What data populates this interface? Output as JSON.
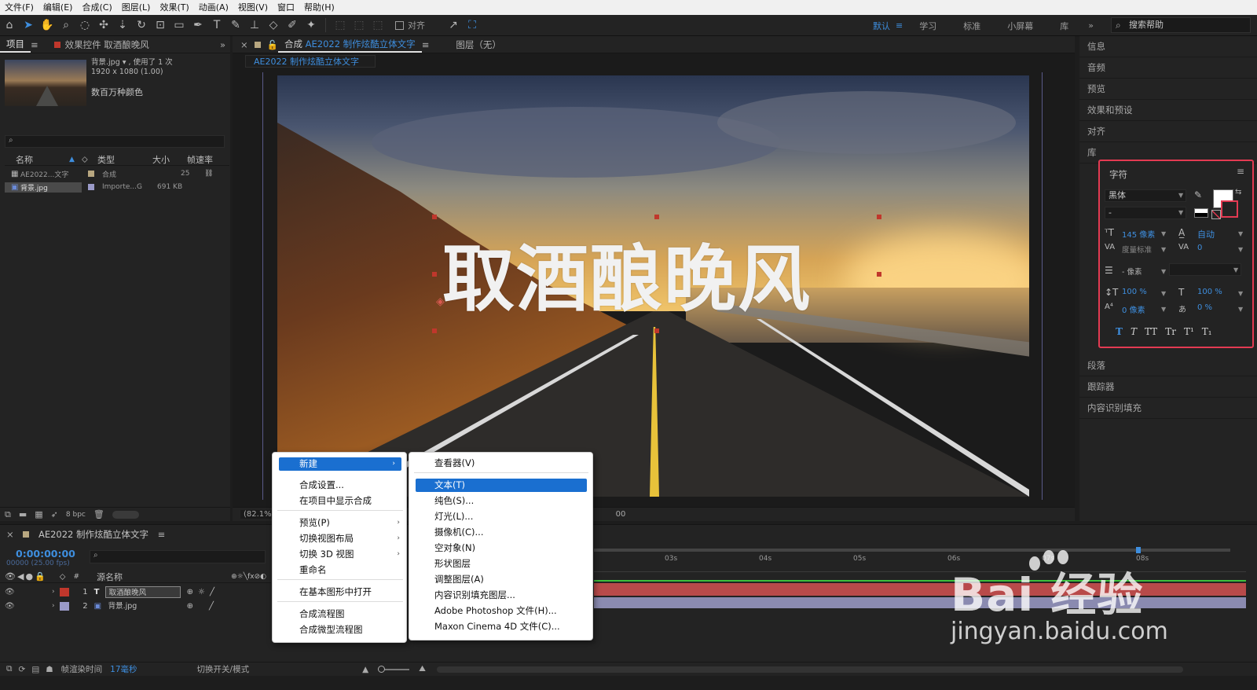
{
  "menubar": [
    "文件(F)",
    "编辑(E)",
    "合成(C)",
    "图层(L)",
    "效果(T)",
    "动画(A)",
    "视图(V)",
    "窗口",
    "帮助(H)"
  ],
  "toolbar": {
    "align_label": "对齐",
    "workspaces": [
      "默认",
      "学习",
      "标准",
      "小屏幕",
      "库"
    ],
    "selected_workspace": "默认",
    "search_placeholder": "搜索帮助"
  },
  "project": {
    "tab_project": "项目",
    "tab_effects": "效果控件 取酒酿晚风",
    "asset_name": "背景.jpg ▾ , 使用了 1 次",
    "asset_size": "1920 x 1080 (1.00)",
    "asset_colors": "数百万种颜色",
    "columns": [
      "名称",
      "类型",
      "大小",
      "帧速率"
    ],
    "items": [
      {
        "name": "AE2022...文字",
        "type": "合成",
        "size": "",
        "fps": "25",
        "color": "#b8a780"
      },
      {
        "name": "背景.jpg",
        "type": "Importe...G",
        "size": "691 KB",
        "fps": "",
        "color": "#9a9ac8"
      }
    ],
    "bpc": "8 bpc"
  },
  "comp": {
    "tab_label": "合成",
    "tab_name": "AE2022 制作炫酷立体文字",
    "layer_tab": "图层（无）",
    "sub_tab": "AE2022 制作炫酷立体文字",
    "title_text": "取酒酿晚风",
    "zoom": "(82.1%)",
    "timecode_tail": "00"
  },
  "right_panels": [
    "信息",
    "音频",
    "预览",
    "效果和预设",
    "对齐",
    "库"
  ],
  "right_panels_below": [
    "段落",
    "跟踪器",
    "内容识别填充"
  ],
  "character": {
    "title": "字符",
    "font": "黑体",
    "style": "-",
    "font_size": "145 像素",
    "leading": "自动",
    "kerning": "度量标准",
    "tracking": "0",
    "stroke_width": "- 像素",
    "vscale": "100 %",
    "hscale": "100 %",
    "baseline": "0 像素",
    "tsume": "0 %",
    "styles": [
      "T",
      "T",
      "TT",
      "Tr",
      "T¹",
      "T₁"
    ]
  },
  "timeline": {
    "tab_name": "AE2022 制作炫酷立体文字",
    "timecode": "0:00:00:00",
    "fps": "00000 (25.00 fps)",
    "columns": [
      "#",
      "源名称"
    ],
    "layers": [
      {
        "num": "1",
        "name": "取酒酿晚风",
        "type_icon": "T",
        "color": "#c0372c"
      },
      {
        "num": "2",
        "name": "背景.jpg",
        "type_icon": "▣",
        "color": "#9a9ac8"
      }
    ],
    "ruler_ticks": [
      "03s",
      "04s",
      "05s",
      "06s",
      "07s",
      "08s"
    ],
    "render_label": "帧渲染时间",
    "render_value": "17毫秒",
    "switch_label": "切换开关/模式"
  },
  "context_menu": {
    "items": [
      {
        "label": "新建",
        "submenu": true,
        "highlight": true
      },
      {
        "label": "合成设置..."
      },
      {
        "label": "在项目中显示合成"
      },
      {
        "label": "预览(P)",
        "submenu": true
      },
      {
        "label": "切换视图布局",
        "submenu": true
      },
      {
        "label": "切换 3D 视图",
        "submenu": true
      },
      {
        "label": "重命名"
      },
      {
        "label": "在基本图形中打开"
      },
      {
        "label": "合成流程图"
      },
      {
        "label": "合成微型流程图"
      }
    ]
  },
  "submenu": {
    "items": [
      {
        "label": "查看器(V)"
      },
      {
        "label": "文本(T)",
        "highlight": true
      },
      {
        "label": "纯色(S)..."
      },
      {
        "label": "灯光(L)..."
      },
      {
        "label": "摄像机(C)..."
      },
      {
        "label": "空对象(N)"
      },
      {
        "label": "形状图层"
      },
      {
        "label": "调整图层(A)"
      },
      {
        "label": "内容识别填充图层..."
      },
      {
        "label": "Adobe Photoshop 文件(H)..."
      },
      {
        "label": "Maxon Cinema 4D 文件(C)..."
      }
    ]
  },
  "watermark": {
    "logo": "Bai 经验",
    "url": "jingyan.baidu.com"
  },
  "colors": {
    "accent": "#3e8ede",
    "highlight_box": "#e33a52",
    "menu_highlight": "#1a6fd0"
  }
}
